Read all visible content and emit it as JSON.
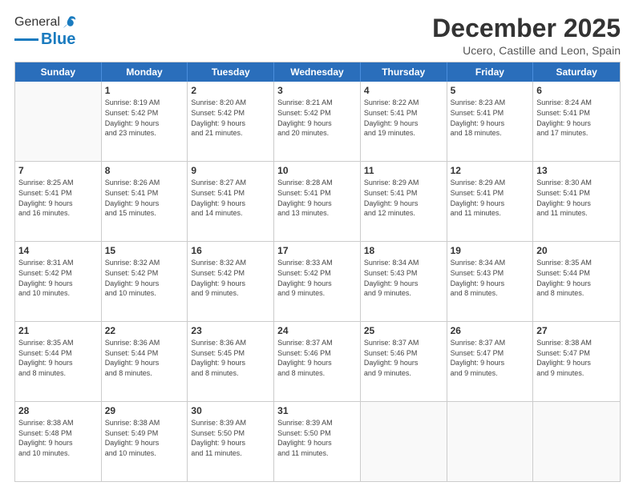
{
  "logo": {
    "general": "General",
    "blue": "Blue"
  },
  "title": "December 2025",
  "subtitle": "Ucero, Castille and Leon, Spain",
  "header_days": [
    "Sunday",
    "Monday",
    "Tuesday",
    "Wednesday",
    "Thursday",
    "Friday",
    "Saturday"
  ],
  "rows": [
    [
      {
        "day": "",
        "text": ""
      },
      {
        "day": "1",
        "text": "Sunrise: 8:19 AM\nSunset: 5:42 PM\nDaylight: 9 hours\nand 23 minutes."
      },
      {
        "day": "2",
        "text": "Sunrise: 8:20 AM\nSunset: 5:42 PM\nDaylight: 9 hours\nand 21 minutes."
      },
      {
        "day": "3",
        "text": "Sunrise: 8:21 AM\nSunset: 5:42 PM\nDaylight: 9 hours\nand 20 minutes."
      },
      {
        "day": "4",
        "text": "Sunrise: 8:22 AM\nSunset: 5:41 PM\nDaylight: 9 hours\nand 19 minutes."
      },
      {
        "day": "5",
        "text": "Sunrise: 8:23 AM\nSunset: 5:41 PM\nDaylight: 9 hours\nand 18 minutes."
      },
      {
        "day": "6",
        "text": "Sunrise: 8:24 AM\nSunset: 5:41 PM\nDaylight: 9 hours\nand 17 minutes."
      }
    ],
    [
      {
        "day": "7",
        "text": "Sunrise: 8:25 AM\nSunset: 5:41 PM\nDaylight: 9 hours\nand 16 minutes."
      },
      {
        "day": "8",
        "text": "Sunrise: 8:26 AM\nSunset: 5:41 PM\nDaylight: 9 hours\nand 15 minutes."
      },
      {
        "day": "9",
        "text": "Sunrise: 8:27 AM\nSunset: 5:41 PM\nDaylight: 9 hours\nand 14 minutes."
      },
      {
        "day": "10",
        "text": "Sunrise: 8:28 AM\nSunset: 5:41 PM\nDaylight: 9 hours\nand 13 minutes."
      },
      {
        "day": "11",
        "text": "Sunrise: 8:29 AM\nSunset: 5:41 PM\nDaylight: 9 hours\nand 12 minutes."
      },
      {
        "day": "12",
        "text": "Sunrise: 8:29 AM\nSunset: 5:41 PM\nDaylight: 9 hours\nand 11 minutes."
      },
      {
        "day": "13",
        "text": "Sunrise: 8:30 AM\nSunset: 5:41 PM\nDaylight: 9 hours\nand 11 minutes."
      }
    ],
    [
      {
        "day": "14",
        "text": "Sunrise: 8:31 AM\nSunset: 5:42 PM\nDaylight: 9 hours\nand 10 minutes."
      },
      {
        "day": "15",
        "text": "Sunrise: 8:32 AM\nSunset: 5:42 PM\nDaylight: 9 hours\nand 10 minutes."
      },
      {
        "day": "16",
        "text": "Sunrise: 8:32 AM\nSunset: 5:42 PM\nDaylight: 9 hours\nand 9 minutes."
      },
      {
        "day": "17",
        "text": "Sunrise: 8:33 AM\nSunset: 5:42 PM\nDaylight: 9 hours\nand 9 minutes."
      },
      {
        "day": "18",
        "text": "Sunrise: 8:34 AM\nSunset: 5:43 PM\nDaylight: 9 hours\nand 9 minutes."
      },
      {
        "day": "19",
        "text": "Sunrise: 8:34 AM\nSunset: 5:43 PM\nDaylight: 9 hours\nand 8 minutes."
      },
      {
        "day": "20",
        "text": "Sunrise: 8:35 AM\nSunset: 5:44 PM\nDaylight: 9 hours\nand 8 minutes."
      }
    ],
    [
      {
        "day": "21",
        "text": "Sunrise: 8:35 AM\nSunset: 5:44 PM\nDaylight: 9 hours\nand 8 minutes."
      },
      {
        "day": "22",
        "text": "Sunrise: 8:36 AM\nSunset: 5:44 PM\nDaylight: 9 hours\nand 8 minutes."
      },
      {
        "day": "23",
        "text": "Sunrise: 8:36 AM\nSunset: 5:45 PM\nDaylight: 9 hours\nand 8 minutes."
      },
      {
        "day": "24",
        "text": "Sunrise: 8:37 AM\nSunset: 5:46 PM\nDaylight: 9 hours\nand 8 minutes."
      },
      {
        "day": "25",
        "text": "Sunrise: 8:37 AM\nSunset: 5:46 PM\nDaylight: 9 hours\nand 9 minutes."
      },
      {
        "day": "26",
        "text": "Sunrise: 8:37 AM\nSunset: 5:47 PM\nDaylight: 9 hours\nand 9 minutes."
      },
      {
        "day": "27",
        "text": "Sunrise: 8:38 AM\nSunset: 5:47 PM\nDaylight: 9 hours\nand 9 minutes."
      }
    ],
    [
      {
        "day": "28",
        "text": "Sunrise: 8:38 AM\nSunset: 5:48 PM\nDaylight: 9 hours\nand 10 minutes."
      },
      {
        "day": "29",
        "text": "Sunrise: 8:38 AM\nSunset: 5:49 PM\nDaylight: 9 hours\nand 10 minutes."
      },
      {
        "day": "30",
        "text": "Sunrise: 8:39 AM\nSunset: 5:50 PM\nDaylight: 9 hours\nand 11 minutes."
      },
      {
        "day": "31",
        "text": "Sunrise: 8:39 AM\nSunset: 5:50 PM\nDaylight: 9 hours\nand 11 minutes."
      },
      {
        "day": "",
        "text": ""
      },
      {
        "day": "",
        "text": ""
      },
      {
        "day": "",
        "text": ""
      }
    ]
  ]
}
